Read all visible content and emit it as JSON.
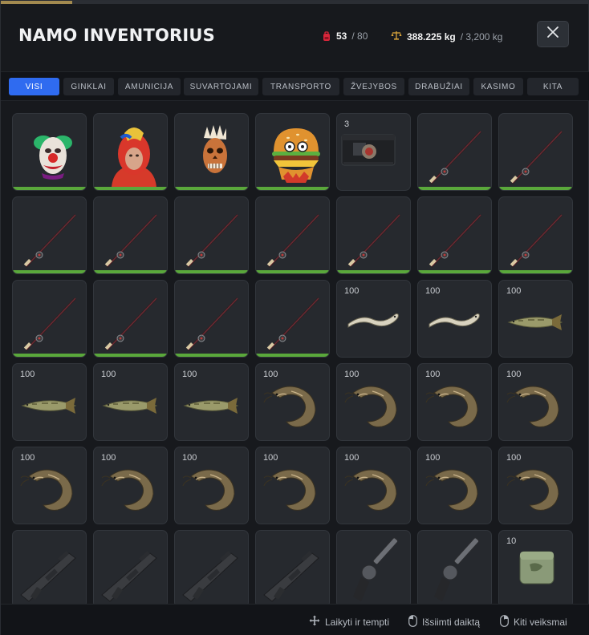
{
  "title": "NAMO INVENTORIUS",
  "slots": {
    "value": "53",
    "max": "/ 80",
    "icon": "backpack-icon",
    "color": "#d8263a"
  },
  "weight": {
    "value": "388.225 kg",
    "max": "/ 3,200 kg",
    "icon": "scale-icon",
    "fraction": 0.121
  },
  "close_icon": "close-icon",
  "tabs": [
    {
      "label": "VISI",
      "active": true
    },
    {
      "label": "GINKLAI"
    },
    {
      "label": "AMUNICIJA"
    },
    {
      "label": "SUVARTOJAMI"
    },
    {
      "label": "TRANSPORTO"
    },
    {
      "label": "ŽVEJYBOS"
    },
    {
      "label": "DRABUŽIAI"
    },
    {
      "label": "KASIMO"
    },
    {
      "label": "KITA"
    }
  ],
  "items": [
    {
      "type": "clown-mask",
      "count": "",
      "bar": true
    },
    {
      "type": "parrot-costume",
      "count": "",
      "bar": true
    },
    {
      "type": "skull-mask",
      "count": "",
      "bar": true
    },
    {
      "type": "burger-mask",
      "count": "",
      "bar": true
    },
    {
      "type": "weapon-case",
      "count": "3",
      "bar": false
    },
    {
      "type": "fishing-rod",
      "count": "",
      "bar": true
    },
    {
      "type": "fishing-rod",
      "count": "",
      "bar": true
    },
    {
      "type": "fishing-rod",
      "count": "",
      "bar": true
    },
    {
      "type": "fishing-rod",
      "count": "",
      "bar": true
    },
    {
      "type": "fishing-rod",
      "count": "",
      "bar": true
    },
    {
      "type": "fishing-rod",
      "count": "",
      "bar": true
    },
    {
      "type": "fishing-rod",
      "count": "",
      "bar": true
    },
    {
      "type": "fishing-rod",
      "count": "",
      "bar": true
    },
    {
      "type": "fishing-rod",
      "count": "",
      "bar": true
    },
    {
      "type": "fishing-rod",
      "count": "",
      "bar": true
    },
    {
      "type": "fishing-rod",
      "count": "",
      "bar": true
    },
    {
      "type": "fishing-rod",
      "count": "",
      "bar": true
    },
    {
      "type": "fishing-rod",
      "count": "",
      "bar": true
    },
    {
      "type": "eel",
      "count": "100",
      "bar": false
    },
    {
      "type": "eel",
      "count": "100",
      "bar": false
    },
    {
      "type": "pike",
      "count": "100",
      "bar": false
    },
    {
      "type": "pike",
      "count": "100",
      "bar": false
    },
    {
      "type": "pike",
      "count": "100",
      "bar": false
    },
    {
      "type": "pike",
      "count": "100",
      "bar": false
    },
    {
      "type": "catfish",
      "count": "100",
      "bar": false
    },
    {
      "type": "catfish",
      "count": "100",
      "bar": false
    },
    {
      "type": "catfish",
      "count": "100",
      "bar": false
    },
    {
      "type": "catfish",
      "count": "100",
      "bar": false
    },
    {
      "type": "catfish",
      "count": "100",
      "bar": false
    },
    {
      "type": "catfish",
      "count": "100",
      "bar": false
    },
    {
      "type": "catfish",
      "count": "100",
      "bar": false
    },
    {
      "type": "catfish",
      "count": "100",
      "bar": false
    },
    {
      "type": "catfish",
      "count": "100",
      "bar": false
    },
    {
      "type": "catfish",
      "count": "100",
      "bar": false
    },
    {
      "type": "catfish",
      "count": "100",
      "bar": false
    },
    {
      "type": "assault-rifle",
      "count": "",
      "bar": true
    },
    {
      "type": "assault-rifle",
      "count": "",
      "bar": true
    },
    {
      "type": "assault-rifle",
      "count": "",
      "bar": true
    },
    {
      "type": "assault-rifle",
      "count": "",
      "bar": true
    },
    {
      "type": "revolver",
      "count": "",
      "bar": true
    },
    {
      "type": "revolver",
      "count": "",
      "bar": true
    },
    {
      "type": "pouch",
      "count": "10",
      "bar": false
    }
  ],
  "footer": {
    "drag": {
      "label": "Laikyti ir tempti",
      "icon": "move-icon"
    },
    "take": {
      "label": "Išsiimti daiktą",
      "icon": "mouse-left-icon"
    },
    "more": {
      "label": "Kiti veiksmai",
      "icon": "mouse-right-icon"
    }
  },
  "colors": {
    "accent": "#2f6bf0",
    "durability": "#5aa83b",
    "capacity": "#a38a4f"
  }
}
